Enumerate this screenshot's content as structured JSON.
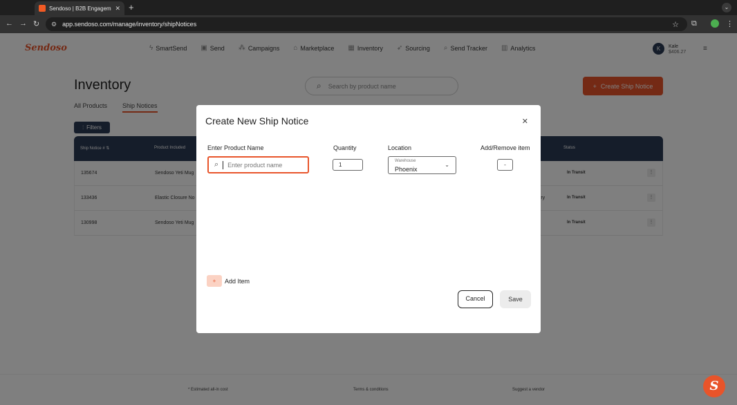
{
  "browser": {
    "tab_title": "Sendoso | B2B Engagement P",
    "tab_close": "✕",
    "new_tab": "+",
    "url": "app.sendoso.com/manage/inventory/shipNotices"
  },
  "header": {
    "logo": "Sendoso",
    "nav": [
      {
        "label": "SmartSend",
        "icon": "bolt-icon",
        "glyph": "ϟ"
      },
      {
        "label": "Send",
        "icon": "gift-icon",
        "glyph": "▣"
      },
      {
        "label": "Campaigns",
        "icon": "campaigns-icon",
        "glyph": "⁂"
      },
      {
        "label": "Marketplace",
        "icon": "marketplace-icon",
        "glyph": "⌂"
      },
      {
        "label": "Inventory",
        "icon": "inventory-icon",
        "glyph": "▦"
      },
      {
        "label": "Sourcing",
        "icon": "sourcing-icon",
        "glyph": "➶"
      },
      {
        "label": "Send Tracker",
        "icon": "search-icon",
        "glyph": "⌕"
      },
      {
        "label": "Analytics",
        "icon": "analytics-icon",
        "glyph": "▥"
      }
    ],
    "user": {
      "initial": "K",
      "name": "Kale",
      "balance": "$406.27"
    }
  },
  "page": {
    "title": "Inventory",
    "search_placeholder": "Search by product name",
    "create_button": "Create Ship Notice",
    "tabs": [
      "All Products",
      "Ship Notices"
    ],
    "filters_label": "Filters"
  },
  "table": {
    "headers": {
      "ship_notice": "Ship Notice #",
      "product": "Product Included",
      "status": "Status"
    },
    "rows": [
      {
        "id": "135674",
        "product": "Sendoso Yeti Mug",
        "extra": "",
        "status": "In Transit"
      },
      {
        "id": "133436",
        "product": "Elastic Closure No",
        "extra": "rry",
        "status": "In Transit"
      },
      {
        "id": "130998",
        "product": "Sendoso Yeti Mug",
        "extra": "",
        "status": "In Transit"
      }
    ]
  },
  "footer": {
    "cost_note": "* Estimated all-in cost",
    "terms": "Terms & conditions",
    "suggest": "Suggest a vendor"
  },
  "modal": {
    "title": "Create New Ship Notice",
    "labels": {
      "product": "Enter Product Name",
      "quantity": "Quantity",
      "location": "Location",
      "add_remove": "Add/Remove item"
    },
    "product_placeholder": "Enter product name",
    "quantity_value": "1",
    "location_label": "Warehouse",
    "location_value": "Phoenix",
    "remove_label": "-",
    "add_item_plus": "+",
    "add_item_label": "Add Item",
    "cancel_label": "Cancel",
    "save_label": "Save"
  }
}
